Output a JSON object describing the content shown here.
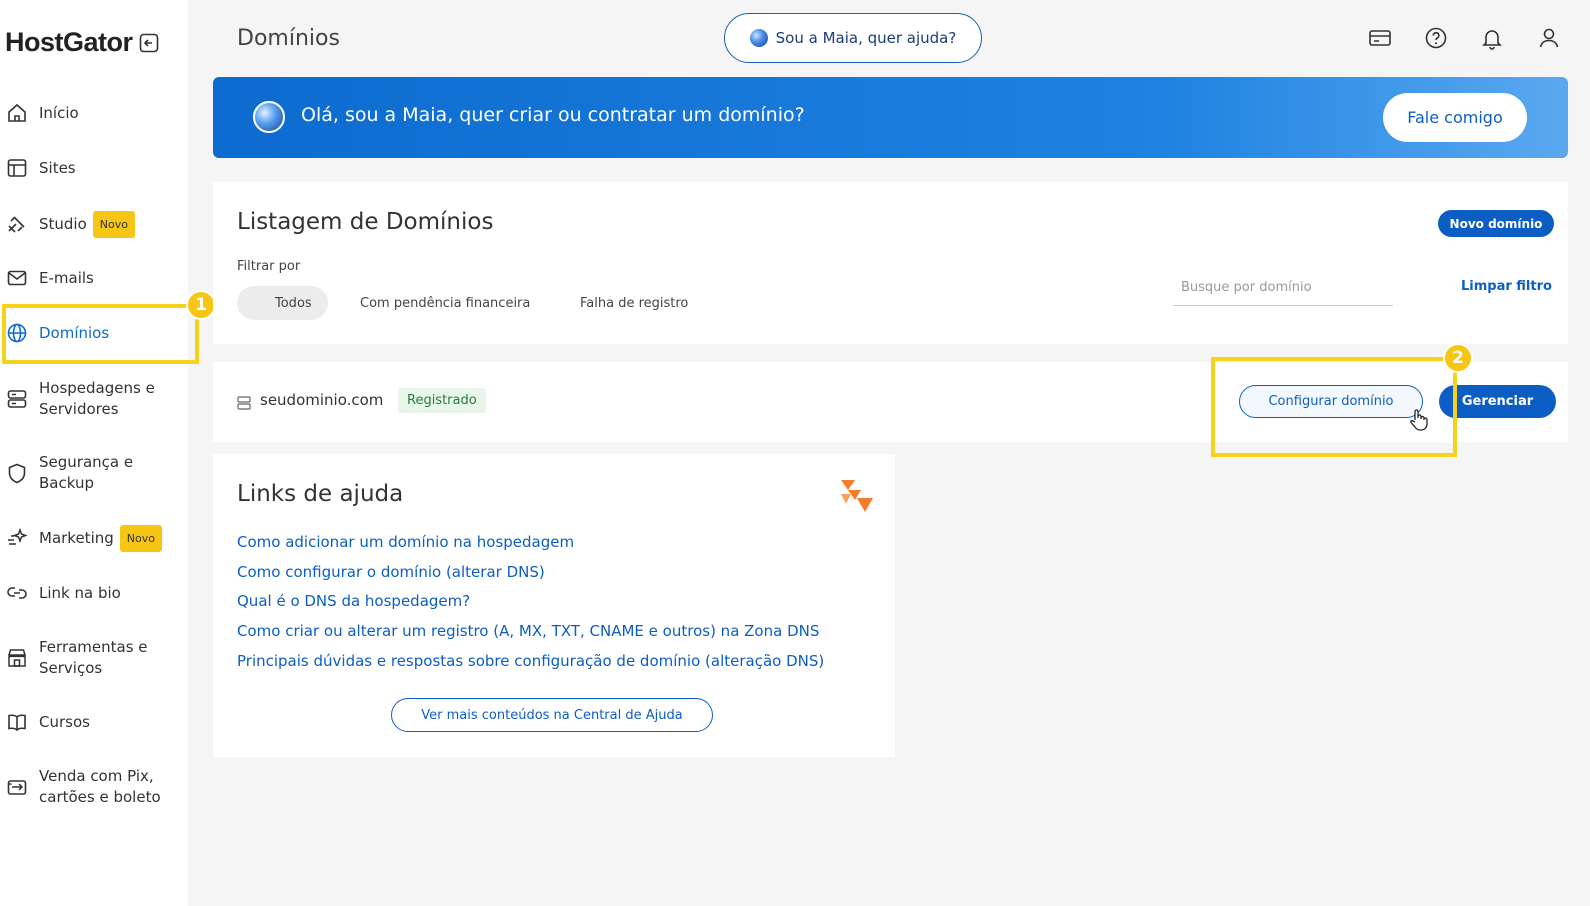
{
  "brand": {
    "name": "HostGator"
  },
  "sidebar": {
    "items": [
      {
        "label": "Início",
        "icon": "home-icon"
      },
      {
        "label": "Sites",
        "icon": "layout-icon"
      },
      {
        "label": "Studio",
        "icon": "studio-icon",
        "badge": "Novo"
      },
      {
        "label": "E-mails",
        "icon": "mail-icon"
      },
      {
        "label": "Domínios",
        "icon": "globe-icon",
        "active": true
      },
      {
        "label": "Hospedagens e Servidores",
        "icon": "server-icon"
      },
      {
        "label": "Segurança e Backup",
        "icon": "shield-icon"
      },
      {
        "label": "Marketing",
        "icon": "sparkle-icon",
        "badge": "Novo"
      },
      {
        "label": "Link na bio",
        "icon": "link-icon"
      },
      {
        "label": "Ferramentas e Serviços",
        "icon": "store-icon"
      },
      {
        "label": "Cursos",
        "icon": "book-icon"
      },
      {
        "label": "Venda com Pix, cartões e boleto",
        "icon": "payment-icon"
      }
    ]
  },
  "header": {
    "title": "Domínios",
    "assistant_label": "Sou a Maia, quer ajuda?"
  },
  "banner": {
    "text": "Olá, sou a Maia, quer criar ou contratar um domínio?",
    "button_label": "Fale comigo"
  },
  "listing": {
    "title": "Listagem de Domínios",
    "new_button": "Novo domínio",
    "filter_label": "Filtrar por",
    "filters": [
      "Todos",
      "Com pendência financeira",
      "Falha de registro"
    ],
    "search_placeholder": "Busque por domínio",
    "clear_filter": "Limpar filtro"
  },
  "domain": {
    "name": "seudominio.com",
    "status": "Registrado",
    "configure_label": "Configurar domínio",
    "manage_label": "Gerenciar"
  },
  "help": {
    "title": "Links de ajuda",
    "links": [
      "Como adicionar um domínio na hospedagem",
      "Como configurar o domínio (alterar DNS)",
      "Qual é o DNS da hospedagem?",
      "Como criar ou alterar um registro (A, MX, TXT, CNAME e outros) na Zona DNS",
      "Principais dúvidas e respostas sobre configuração de domínio (alteração DNS)"
    ],
    "more_label": "Ver mais conteúdos na Central de Ajuda"
  },
  "steps": [
    "1",
    "2"
  ],
  "colors": {
    "accent": "#0d5ec4",
    "highlight": "#f7d21a",
    "badge": "#f7c614"
  }
}
